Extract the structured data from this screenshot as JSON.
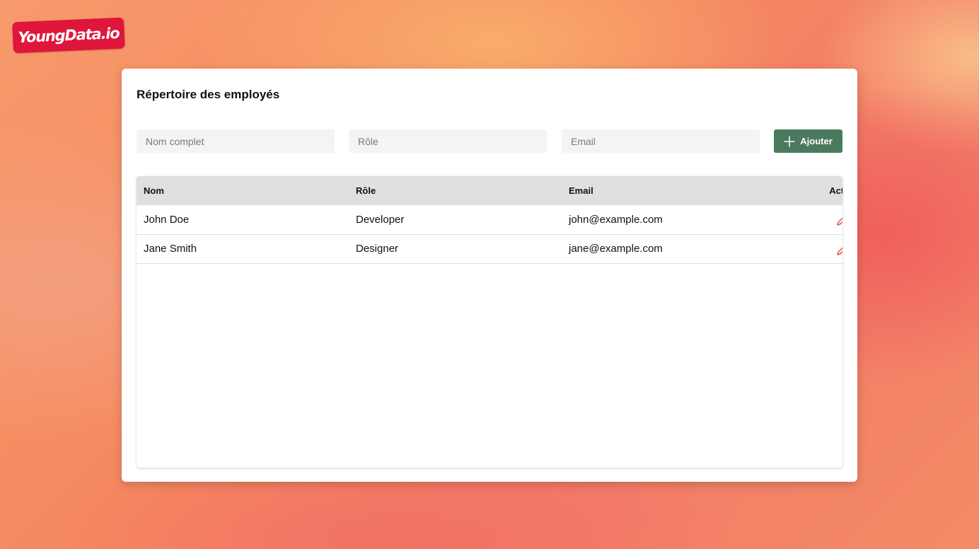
{
  "brand": {
    "logo_text": "YoungData.io",
    "logo_color": "#e0153b"
  },
  "card": {
    "title": "Répertoire des employés"
  },
  "form": {
    "name_placeholder": "Nom complet",
    "role_placeholder": "Rôle",
    "email_placeholder": "Email",
    "add_label": "Ajouter",
    "add_icon": "plus-icon",
    "add_button_color": "#4a7a5d"
  },
  "table": {
    "headers": {
      "name": "Nom",
      "role": "Rôle",
      "email": "Email",
      "action": "Action"
    },
    "rows": [
      {
        "name": "John Doe",
        "role": "Developer",
        "email": "john@example.com",
        "action_icon": "pencil-icon"
      },
      {
        "name": "Jane Smith",
        "role": "Designer",
        "email": "jane@example.com",
        "action_icon": "pencil-icon"
      }
    ],
    "edit_icon_color": "#e05a5a"
  }
}
